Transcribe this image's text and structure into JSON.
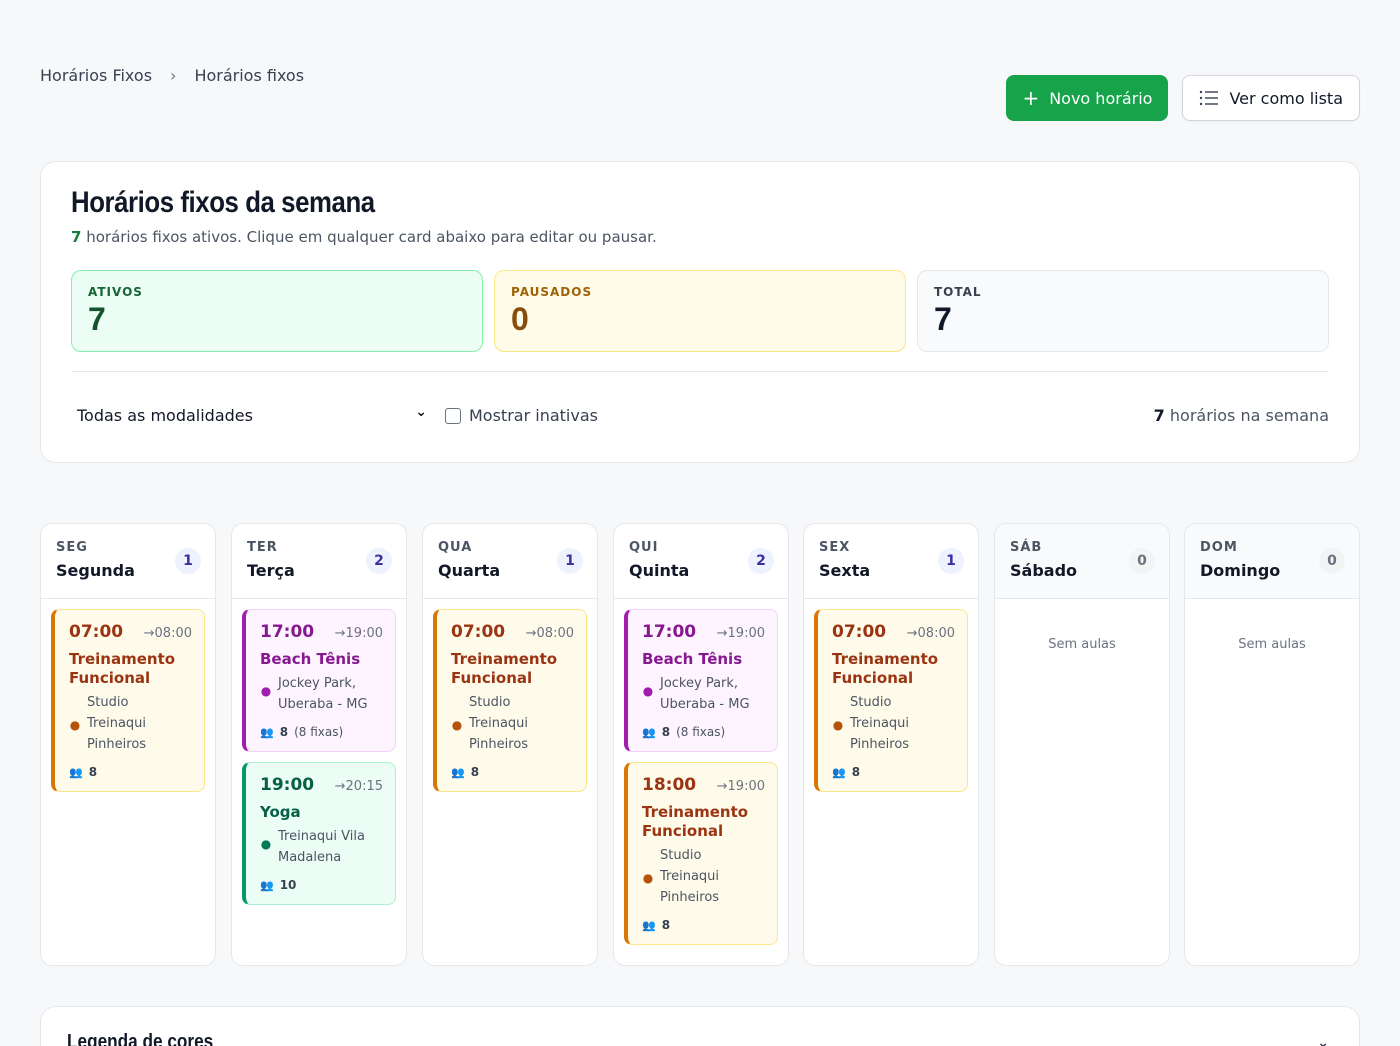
{
  "breadcrumb": {
    "root": "Horários Fixos",
    "current": "Horários fixos"
  },
  "actions": {
    "new_label": "Novo horário",
    "list_label": "Ver como lista"
  },
  "summary": {
    "title": "Horários fixos da semana",
    "active_count": "7",
    "subtitle_rest": "horários fixos ativos. Clique em qualquer card abaixo para editar ou pausar.",
    "stats": [
      {
        "label": "ATIVOS",
        "value": "7"
      },
      {
        "label": "PAUSADOS",
        "value": "0"
      },
      {
        "label": "TOTAL",
        "value": "7"
      }
    ],
    "filter_select": "Todas as modalidades",
    "show_inactive": "Mostrar inativas",
    "week_count": "7",
    "week_count_rest": "horários na semana"
  },
  "days": [
    {
      "abbr": "SEG",
      "name": "Segunda",
      "count": "1"
    },
    {
      "abbr": "TER",
      "name": "Terça",
      "count": "2"
    },
    {
      "abbr": "QUA",
      "name": "Quarta",
      "count": "1"
    },
    {
      "abbr": "QUI",
      "name": "Quinta",
      "count": "2"
    },
    {
      "abbr": "SEX",
      "name": "Sexta",
      "count": "1"
    },
    {
      "abbr": "SÁB",
      "name": "Sábado",
      "count": "0",
      "empty": "Sem aulas"
    },
    {
      "abbr": "DOM",
      "name": "Domingo",
      "count": "0",
      "empty": "Sem aulas"
    }
  ],
  "classes": {
    "seg": [
      {
        "start": "07:00",
        "end": "→08:00",
        "title_1": "Treinamento",
        "title_2": "Funcional",
        "studio": "Studio",
        "loc_1": "Treinaqui",
        "loc_2": "Pinheiros",
        "people": "8"
      }
    ],
    "ter": [
      {
        "start": "17:00",
        "end": "→19:00",
        "title": "Beach Tênis",
        "loc_1": "Jockey Park,",
        "loc_2": "Uberaba - MG",
        "people": "8",
        "fixed": "(8 fixas)"
      },
      {
        "start": "19:00",
        "end": "→20:15",
        "title": "Yoga",
        "loc_1": "Treinaqui Vila",
        "loc_2": "Madalena",
        "people": "10"
      }
    ],
    "qua": [
      {
        "start": "07:00",
        "end": "→08:00",
        "title_1": "Treinamento",
        "title_2": "Funcional",
        "studio": "Studio",
        "loc_1": "Treinaqui",
        "loc_2": "Pinheiros",
        "people": "8"
      }
    ],
    "qui": [
      {
        "start": "17:00",
        "end": "→19:00",
        "title": "Beach Tênis",
        "loc_1": "Jockey Park,",
        "loc_2": "Uberaba - MG",
        "people": "8",
        "fixed": "(8 fixas)"
      },
      {
        "start": "18:00",
        "end": "→19:00",
        "title_1": "Treinamento",
        "title_2": "Funcional",
        "studio": "Studio",
        "loc_1": "Treinaqui",
        "loc_2": "Pinheiros",
        "people": "8"
      }
    ],
    "sex": [
      {
        "start": "07:00",
        "end": "→08:00",
        "title_1": "Treinamento",
        "title_2": "Funcional",
        "studio": "Studio",
        "loc_1": "Treinaqui",
        "loc_2": "Pinheiros",
        "people": "8"
      }
    ]
  },
  "legend": {
    "title": "Legenda de cores"
  },
  "icons": {
    "plus": "plus-icon",
    "list": "list-icon",
    "chevron": "chevron-down-icon",
    "pin": "map-pin-icon",
    "people": "users-icon"
  },
  "colors": {
    "primary": "#16a34a",
    "orange": "#d97706",
    "purple": "#a21caf",
    "green": "#059669"
  }
}
